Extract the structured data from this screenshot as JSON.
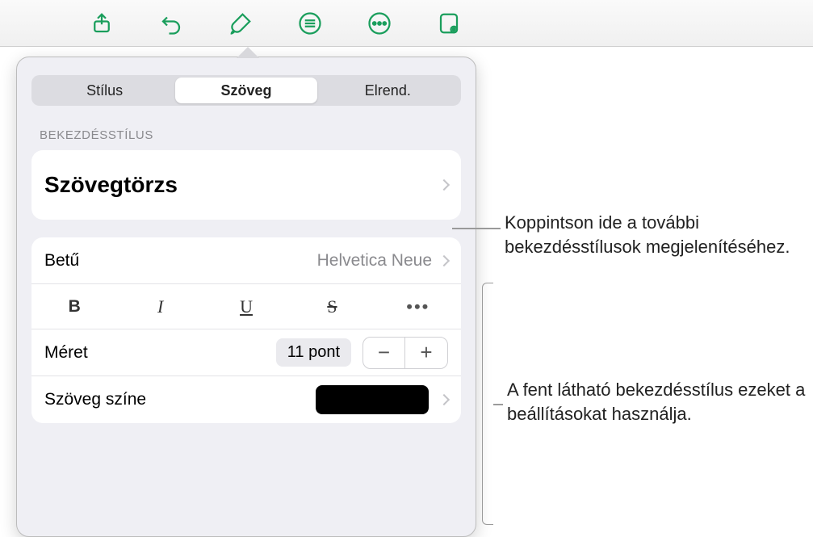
{
  "toolbar": {
    "icons": [
      "share",
      "undo",
      "format",
      "list",
      "more",
      "presenter"
    ]
  },
  "tabs": {
    "style": "Stílus",
    "text": "Szöveg",
    "layout": "Elrend."
  },
  "section_label": "BEKEZDÉSSTÍLUS",
  "paragraph_style": "Szövegtörzs",
  "font": {
    "label": "Betű",
    "value": "Helvetica Neue"
  },
  "bius": {
    "bold": "B",
    "italic": "I",
    "underline": "U",
    "strike": "S",
    "more": "•••"
  },
  "size": {
    "label": "Méret",
    "value": "11 pont",
    "minus": "−",
    "plus": "+"
  },
  "text_color": {
    "label": "Szöveg színe"
  },
  "callouts": {
    "top": "Koppintson ide a további bekezdésstílusok megjelenítéséhez.",
    "bottom": "A fent látható bekezdésstílus ezeket a beállításokat használja."
  }
}
